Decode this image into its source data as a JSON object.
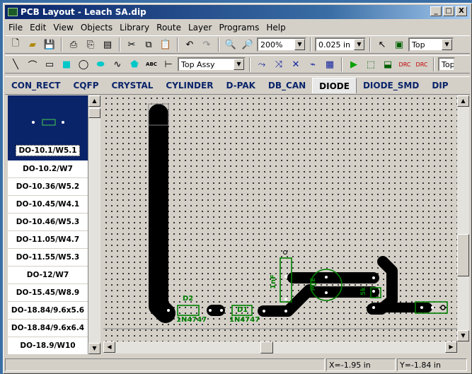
{
  "window": {
    "title": "PCB Layout - Leach SA.dip",
    "minimize": "_",
    "maximize": "□",
    "close": "X"
  },
  "menu": [
    "File",
    "Edit",
    "View",
    "Objects",
    "Library",
    "Route",
    "Layer",
    "Programs",
    "Help"
  ],
  "toolbar1": {
    "zoom": "200%",
    "grid": "0.025 in",
    "layer": "Top"
  },
  "toolbar2": {
    "text_tool": "ABC",
    "assy_layer": "Top Assy",
    "right_combo": "Top"
  },
  "library_tabs": [
    "CON_RECT",
    "CQFP",
    "CRYSTAL",
    "CYLINDER",
    "D-PAK",
    "DB_CAN",
    "DIODE",
    "DIODE_SMD",
    "DIP"
  ],
  "active_tab": "DIODE",
  "parts": {
    "selected": "DO-10.1/W5.1",
    "items": [
      "DO-10.2/W7",
      "DO-10.36/W5.2",
      "DO-10.45/W4.1",
      "DO-10.46/W5.3",
      "DO-11.05/W4.7",
      "DO-11.55/W5.3",
      "DO-12/W7",
      "DO-15.45/W8.9",
      "DO-18.84/9.6x5.6",
      "DO-18.84/9.6x6.4",
      "DO-18.9/W10"
    ]
  },
  "board": {
    "d2_ref": "D2",
    "d2_val": "1N4747",
    "d1_ref": "D1",
    "d1_val": "1N4747",
    "cap_label": "1nF",
    "q_label": "MJE",
    "r_label": "5k"
  },
  "status": {
    "x": "X=-1.95 in",
    "y": "Y=-1.84 in"
  },
  "colors": {
    "titlebar": "#0a246a",
    "silkscreen": "#008000",
    "trace": "#000000",
    "board_bg": "#d4d0c8"
  }
}
